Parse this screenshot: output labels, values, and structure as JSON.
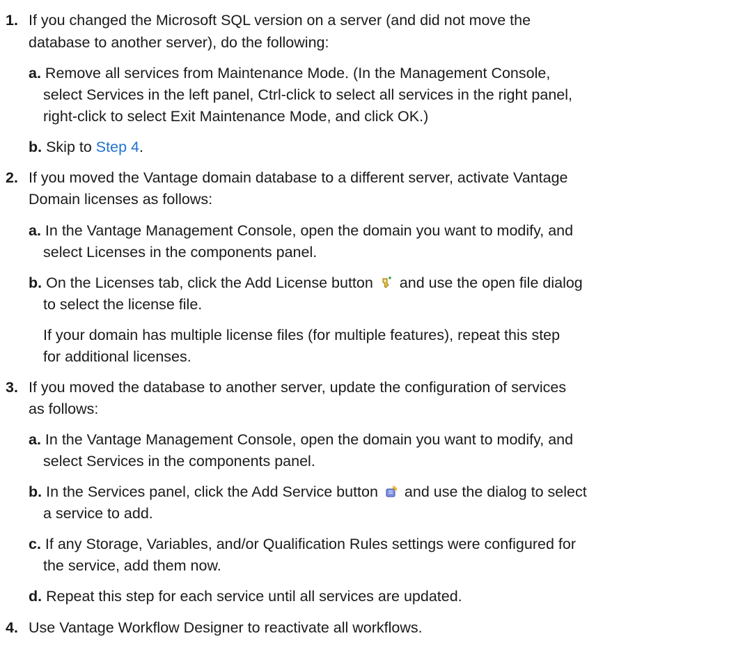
{
  "steps": [
    {
      "num": "1.",
      "lines": [
        "If you changed the Microsoft SQL version on a server (and did not move the",
        "database to another server), do the following:"
      ],
      "sub": [
        {
          "label": "a.",
          "lines": [
            "Remove all services from Maintenance Mode. (In the Management Console,",
            "select Services in the left panel, Ctrl-click to select all services in the right panel,",
            "right-click to select Exit Maintenance Mode, and click OK.)"
          ]
        },
        {
          "label": "b.",
          "prefix": "Skip to ",
          "link": "Step 4",
          "suffix": "."
        }
      ]
    },
    {
      "num": "2.",
      "lines": [
        "If you moved the Vantage domain database to a different server, activate Vantage",
        "Domain licenses as follows:"
      ],
      "sub": [
        {
          "label": "a.",
          "lines": [
            "In the Vantage Management Console, open the domain you want to modify, and",
            "select Licenses in the components panel."
          ]
        },
        {
          "label": "b.",
          "line1_before_icon": "On the Licenses tab, click the Add License button",
          "line1_after_icon": "and use the open file dialog",
          "line2": "to select the license file.",
          "icon": "add-license-icon",
          "note_lines": [
            "If your domain has multiple license files (for multiple features), repeat this step",
            "for additional licenses."
          ]
        }
      ]
    },
    {
      "num": "3.",
      "lines": [
        "If you moved the database to another server, update the configuration of services",
        "as follows:"
      ],
      "sub": [
        {
          "label": "a.",
          "lines": [
            "In the Vantage Management Console, open the domain you want to modify, and",
            "select Services in the components panel."
          ]
        },
        {
          "label": "b.",
          "line1_before_icon": "In the Services panel, click the Add Service button",
          "line1_after_icon": "and use the dialog to select",
          "line2": "a service to add.",
          "icon": "add-service-icon"
        },
        {
          "label": "c.",
          "lines": [
            "If any Storage, Variables, and/or Qualification Rules settings were configured for",
            "the service, add them now."
          ]
        },
        {
          "label": "d.",
          "lines": [
            "Repeat this step for each service until all services are updated."
          ]
        }
      ]
    },
    {
      "num": "4.",
      "lines": [
        "Use Vantage Workflow Designer to reactivate all workflows."
      ]
    }
  ],
  "colors": {
    "text": "#1a1a1a",
    "link": "#1e73d2"
  }
}
